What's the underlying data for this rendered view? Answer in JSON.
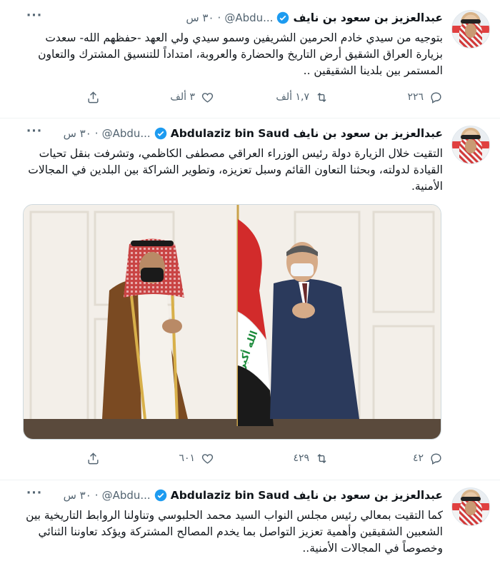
{
  "tweets": [
    {
      "name": "عبدالعزيز بن سعود بن نايف",
      "handle": "@Abdu...",
      "dot": "·",
      "time": "٣٠ س",
      "more": "···",
      "text": "بتوجيه من سيدي خادم الحرمين الشريفين وسمو سيدي ولي العهد -حفظهم الله- سعدت بزيارة العراق الشقيق أرض التاريخ والحضارة والعروبة، امتداداً للتنسيق المشترك والتعاون المستمر بين بلدينا الشقيقين ..",
      "replies": "٢٢٦",
      "retweets": "١,٧ ألف",
      "likes": "٣ ألف"
    },
    {
      "name": "Abdulaziz bin Saud عبدالعزيز بن سعود بن نايف",
      "handle": "@Abdu...",
      "dot": "·",
      "time": "٣٠ س",
      "more": "···",
      "text": "التقيت خلال الزيارة دولة رئيس الوزراء العراقي مصطفى الكاظمي، وتشرفت بنقل تحيات القيادة لدولته، وبحثنا التعاون القائم وسبل تعزيزه، وتطوير الشراكة بين البلدين في المجالات الأمنية.",
      "flag_text": "الله أكبر",
      "replies": "٤٢",
      "retweets": "٤٢٩",
      "likes": "٦٠١"
    },
    {
      "name": "Abdulaziz bin Saud عبدالعزيز بن سعود بن نايف",
      "handle": "@Abdu...",
      "dot": "·",
      "time": "٣٠ س",
      "more": "···",
      "text": "كما التقيت بمعالي رئيس مجلس النواب السيد محمد الحلبوسي وتناولنا الروابط التاريخية بين الشعبين الشقيقين وأهمية تعزيز التواصل بما يخدم المصالح المشتركة ويؤكد تعاوننا الثنائي وخصوصاً في المجالات الأمنية.."
    }
  ],
  "colors": {
    "text": "#0f1419",
    "muted": "#536471",
    "verified": "#1d9bf0",
    "divider": "#eff3f4"
  },
  "icons": [
    "verified-badge-icon",
    "reply-icon",
    "retweet-icon",
    "like-icon",
    "share-icon",
    "more-icon"
  ]
}
